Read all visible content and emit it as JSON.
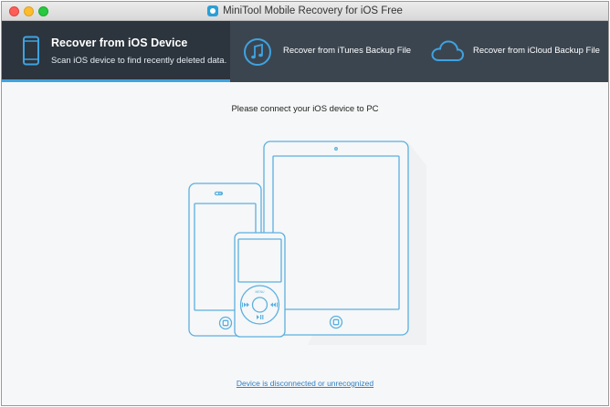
{
  "window": {
    "title": "MiniTool Mobile Recovery for iOS Free"
  },
  "nav": {
    "items": [
      {
        "title": "Recover from iOS Device",
        "subtitle": "Scan iOS device to find recently deleted data.",
        "icon": "phone-icon",
        "active": true
      },
      {
        "title": "Recover from iTunes Backup File",
        "icon": "music-note-icon",
        "active": false
      },
      {
        "title": "Recover from iCloud Backup File",
        "icon": "cloud-icon",
        "active": false
      }
    ]
  },
  "main": {
    "prompt": "Please connect your iOS device to PC",
    "ipod_menu_label": "MENU",
    "status_link": "Device is disconnected or unrecognized"
  },
  "colors": {
    "nav_background": "#3b4550",
    "nav_active_background": "#2c343d",
    "accent": "#3ea3e0",
    "device_outline": "#5bb0e0",
    "link": "#2f7fc4"
  }
}
